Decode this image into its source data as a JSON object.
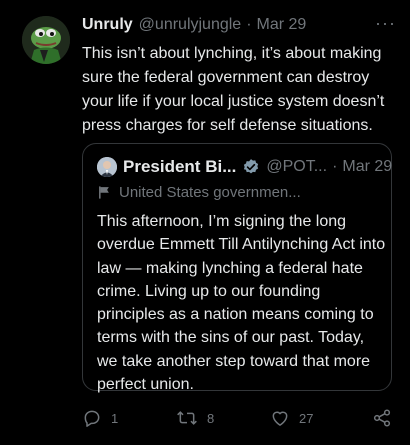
{
  "tweet": {
    "author_name": "Unruly",
    "author_handle": "@unrulyjungle",
    "separator": "·",
    "date": "Mar 29",
    "more_label": "···",
    "text": "This isn’t about lynching, it’s about making sure the federal government can destroy your life if your local justice system doesn’t press charges for self defense situations."
  },
  "quoted_tweet": {
    "author_name": "President Bi...",
    "author_handle": "@POT...",
    "separator": "·",
    "date": "Mar 29",
    "account_label": "United States governmen...",
    "text": "This afternoon, I’m signing the long overdue Emmett Till Antilynching Act into law — making lynching a federal hate crime. Living up to our founding principles as a nation means coming to terms with the sins of our past. Today, we take another step toward that more perfect union."
  },
  "actions": {
    "reply_count": "1",
    "retweet_count": "8",
    "like_count": "27",
    "icons": [
      "reply-icon",
      "retweet-icon",
      "like-icon",
      "share-icon"
    ]
  },
  "colors": {
    "background": "#000000",
    "text_primary": "#e7e9ea",
    "text_secondary": "#71767b",
    "verified": "#829aab",
    "border": "#333639"
  }
}
